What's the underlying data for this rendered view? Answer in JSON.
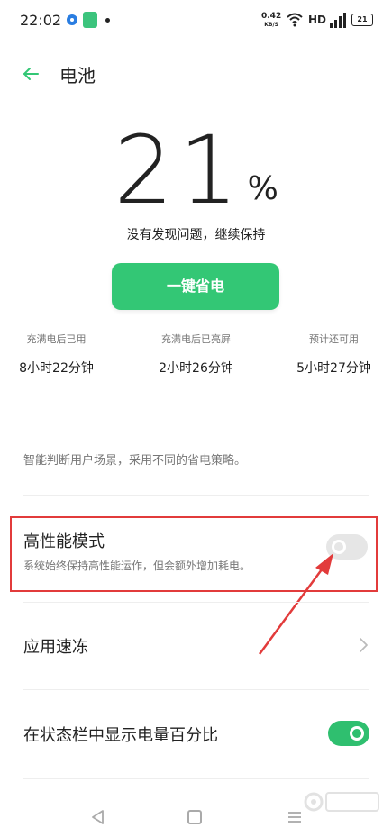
{
  "status_bar": {
    "time": "22:02",
    "net_speed_value": "0.42",
    "net_speed_unit": "KB/S",
    "hd_label": "HD",
    "battery_level": "21"
  },
  "header": {
    "title": "电池"
  },
  "battery": {
    "percent": "21",
    "percent_sign": "%",
    "status_message": "没有发现问题，继续保持"
  },
  "save_button_label": "一键省电",
  "stats": [
    {
      "label": "充满电后已用",
      "value": "8小时22分钟"
    },
    {
      "label": "充满电后已亮屏",
      "value": "2小时26分钟"
    },
    {
      "label": "预计还可用",
      "value": "5小时27分钟"
    }
  ],
  "description": "智能判断用户场景，采用不同的省电策略。",
  "settings": {
    "high_performance": {
      "title": "高性能模式",
      "subtitle": "系统始终保持高性能运作，但会额外增加耗电。",
      "enabled": false
    },
    "app_freeze": {
      "title": "应用速冻"
    },
    "show_percentage": {
      "title": "在状态栏中显示电量百分比",
      "enabled": true
    }
  },
  "colors": {
    "accent_green": "#33c775",
    "highlight_red": "#e23b3b"
  },
  "icons": [
    "back-arrow-icon",
    "chevron-right-icon",
    "nav-back-icon",
    "nav-home-icon",
    "nav-menu-icon",
    "wifi-icon",
    "signal-icon"
  ]
}
